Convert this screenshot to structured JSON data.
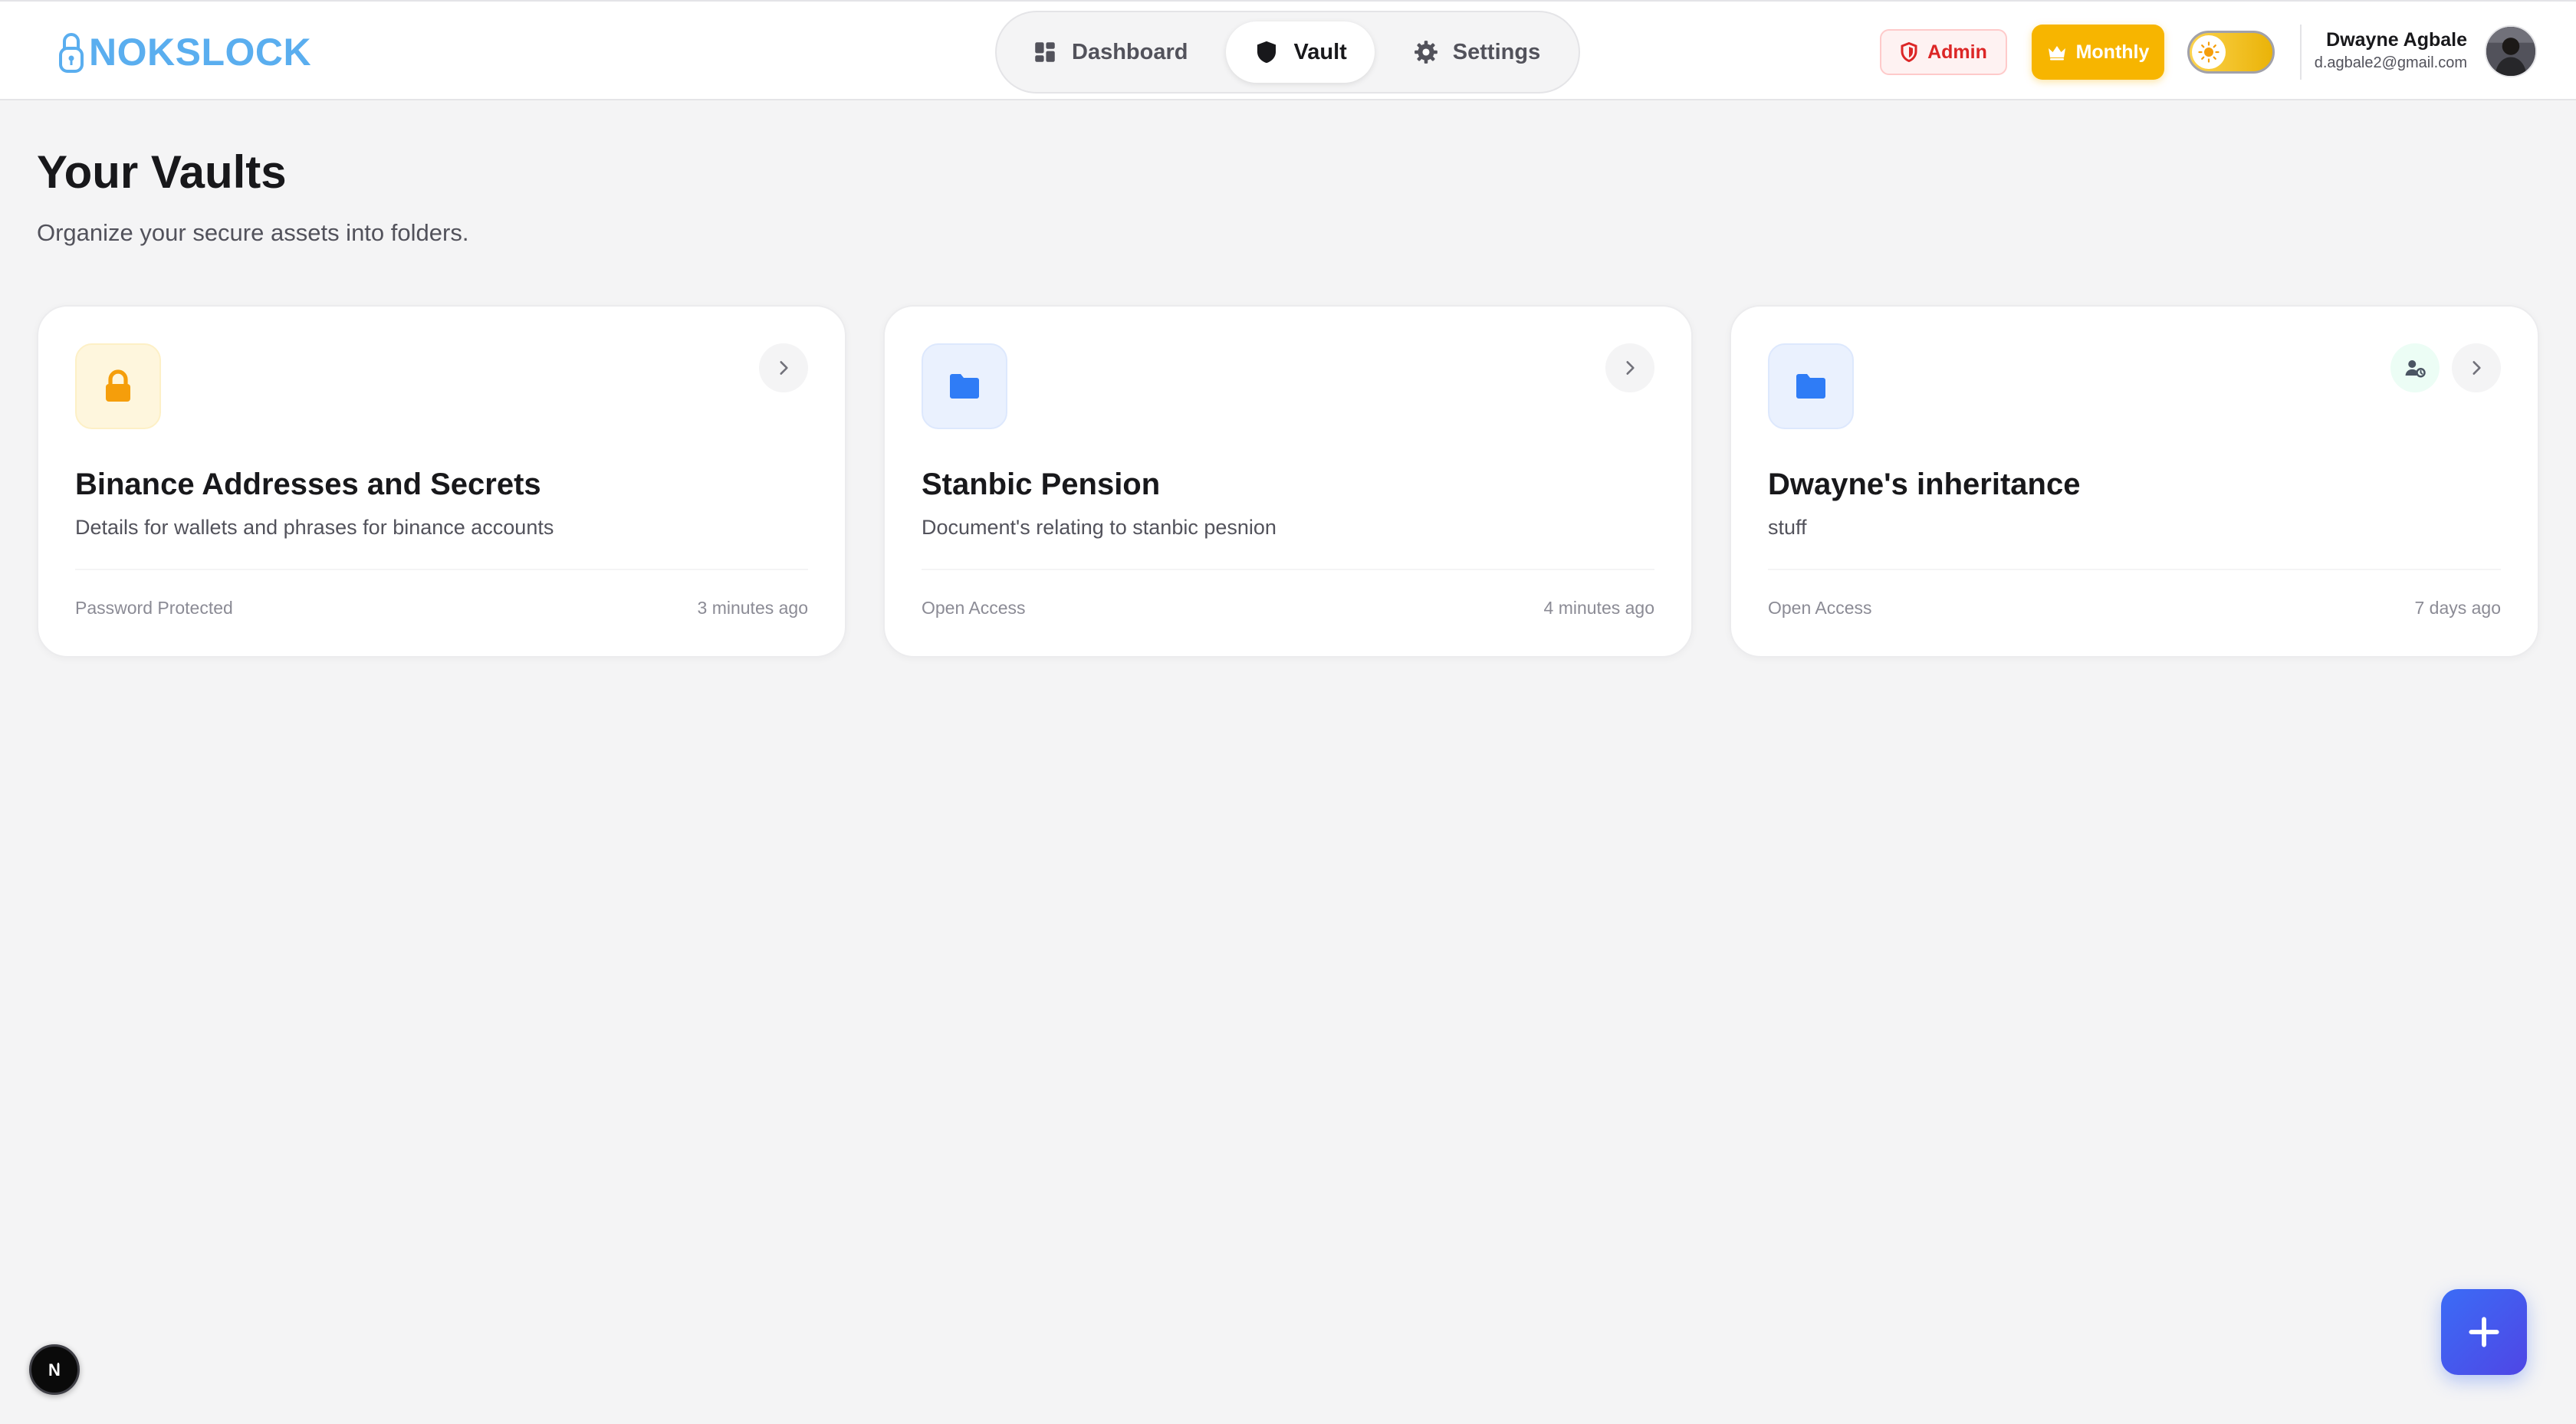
{
  "app": {
    "brand": "NOKSLOCK"
  },
  "nav": {
    "items": [
      {
        "label": "Dashboard",
        "icon": "grid-icon",
        "active": false
      },
      {
        "label": "Vault",
        "icon": "shield-icon",
        "active": true
      },
      {
        "label": "Settings",
        "icon": "gear-icon",
        "active": false
      }
    ]
  },
  "header": {
    "admin_label": "Admin",
    "plan_label": "Monthly",
    "theme": "light",
    "user": {
      "name": "Dwayne Agbale",
      "email": "d.agbale2@gmail.com"
    }
  },
  "page": {
    "title": "Your Vaults",
    "subtitle": "Organize your secure assets into folders."
  },
  "vaults": [
    {
      "name": "Binance Addresses and Secrets",
      "description": "Details for wallets and phrases for binance accounts",
      "access": "Password Protected",
      "updated": "3 minutes ago",
      "icon": "lock-icon",
      "shared": false
    },
    {
      "name": "Stanbic Pension",
      "description": "Document's relating to stanbic pesnion",
      "access": "Open Access",
      "updated": "4 minutes ago",
      "icon": "folder-icon",
      "shared": false
    },
    {
      "name": "Dwayne's inheritance",
      "description": "stuff",
      "access": "Open Access",
      "updated": "7 days ago",
      "icon": "folder-icon",
      "shared": true
    }
  ],
  "colors": {
    "brand": "#5aaeef",
    "admin": "#dc2626",
    "plan": "#f7b500",
    "folder": "#2f7cf6",
    "lock": "#f59e0b",
    "fab": "#3b6cf6"
  },
  "fab": {
    "icon": "plus-icon"
  },
  "dev_indicator": {
    "letter": "N"
  }
}
